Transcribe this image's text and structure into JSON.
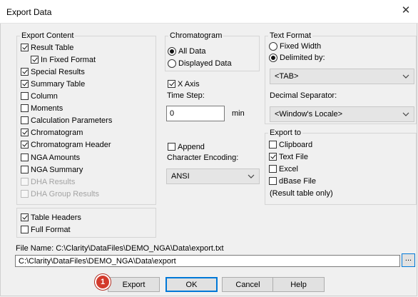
{
  "window": {
    "title": "Export Data",
    "close_glyph": "✕"
  },
  "export_content": {
    "legend": "Export Content",
    "items": [
      {
        "label": "Result Table",
        "checked": true,
        "disabled": false
      },
      {
        "label": "In Fixed Format",
        "checked": true,
        "disabled": false
      },
      {
        "label": "Special Results",
        "checked": true,
        "disabled": false
      },
      {
        "label": "Summary Table",
        "checked": true,
        "disabled": false
      },
      {
        "label": "Column",
        "checked": false,
        "disabled": false
      },
      {
        "label": "Moments",
        "checked": false,
        "disabled": false
      },
      {
        "label": "Calculation Parameters",
        "checked": false,
        "disabled": false
      },
      {
        "label": "Chromatogram",
        "checked": true,
        "disabled": false
      },
      {
        "label": "Chromatogram Header",
        "checked": true,
        "disabled": false
      },
      {
        "label": "NGA Amounts",
        "checked": false,
        "disabled": false
      },
      {
        "label": "NGA Summary",
        "checked": false,
        "disabled": false
      },
      {
        "label": "DHA Results",
        "checked": false,
        "disabled": true
      },
      {
        "label": "DHA Group Results",
        "checked": false,
        "disabled": true
      }
    ]
  },
  "headers_group": {
    "items": [
      {
        "label": "Table Headers",
        "checked": true
      },
      {
        "label": "Full Format",
        "checked": false
      }
    ]
  },
  "chromatogram": {
    "legend": "Chromatogram",
    "all_data": "All Data",
    "displayed_data": "Displayed Data",
    "selected": "all_data",
    "x_axis": "X Axis",
    "x_axis_checked": true,
    "time_step_label": "Time Step:",
    "time_step_value": "0",
    "unit": "min"
  },
  "append": {
    "label": "Append",
    "checked": false
  },
  "encoding": {
    "label": "Character Encoding:",
    "value": "ANSI"
  },
  "text_format": {
    "legend": "Text Format",
    "fixed_width": "Fixed Width",
    "delimited_by": "Delimited by:",
    "selected": "delimited",
    "delimiter_value": "<TAB>",
    "decimal_separator_label": "Decimal Separator:",
    "decimal_separator_value": "<Window's Locale>"
  },
  "export_to": {
    "legend": "Export to",
    "items": [
      {
        "label": "Clipboard",
        "checked": false
      },
      {
        "label": "Text File",
        "checked": true
      },
      {
        "label": "Excel",
        "checked": false
      },
      {
        "label": "dBase File",
        "checked": false
      }
    ],
    "note": "(Result table only)"
  },
  "file": {
    "label": "File Name: C:\\Clarity\\DataFiles\\DEMO_NGA\\Data\\export.txt",
    "value": "C:\\Clarity\\DataFiles\\DEMO_NGA\\Data\\export",
    "browse_label": "..."
  },
  "buttons": {
    "export": "Export",
    "ok": "OK",
    "cancel": "Cancel",
    "help": "Help"
  },
  "callout": {
    "number": "1"
  },
  "colors": {
    "accent": "#0078d7",
    "callout": "#d33a2c",
    "background": "#f0f0f0"
  }
}
